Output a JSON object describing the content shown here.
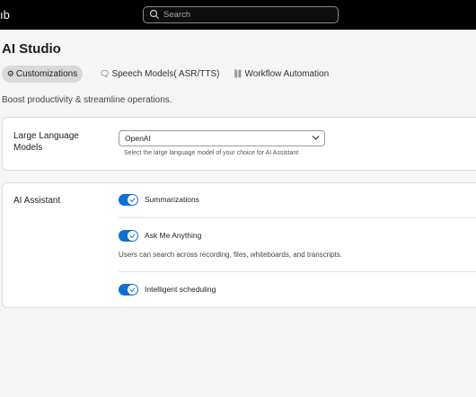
{
  "header": {
    "brand_fragment": "ıb",
    "search_placeholder": "Search"
  },
  "page": {
    "title": "AI Studio",
    "subtitle": "Boost productivity & streamline operations."
  },
  "tabs": [
    {
      "label": "Customizations",
      "icon": "gear-icon",
      "active": true
    },
    {
      "label": "Speech Models( ASR/TTS)",
      "icon": "speech-icon",
      "active": false
    },
    {
      "label": "Workflow Automation",
      "icon": "workflow-icon",
      "active": false
    }
  ],
  "llm": {
    "label": "Large Language Models",
    "selected": "OpenAI",
    "helper": "Select the large language model of your choice for AI Assistant"
  },
  "assistant": {
    "label": "AI Assistant",
    "features": [
      {
        "label": "Summarizations",
        "enabled": true
      },
      {
        "label": "Ask Me Anything",
        "enabled": true,
        "description": "Users can search across recording, files, whiteboards, and transcripts."
      },
      {
        "label": "Intelligent scheduling",
        "enabled": true
      }
    ]
  },
  "colors": {
    "topbar": "#000000",
    "toggle_on": "#1170cf",
    "active_tab": "#d9d9d9",
    "background": "#f5f5f5"
  }
}
